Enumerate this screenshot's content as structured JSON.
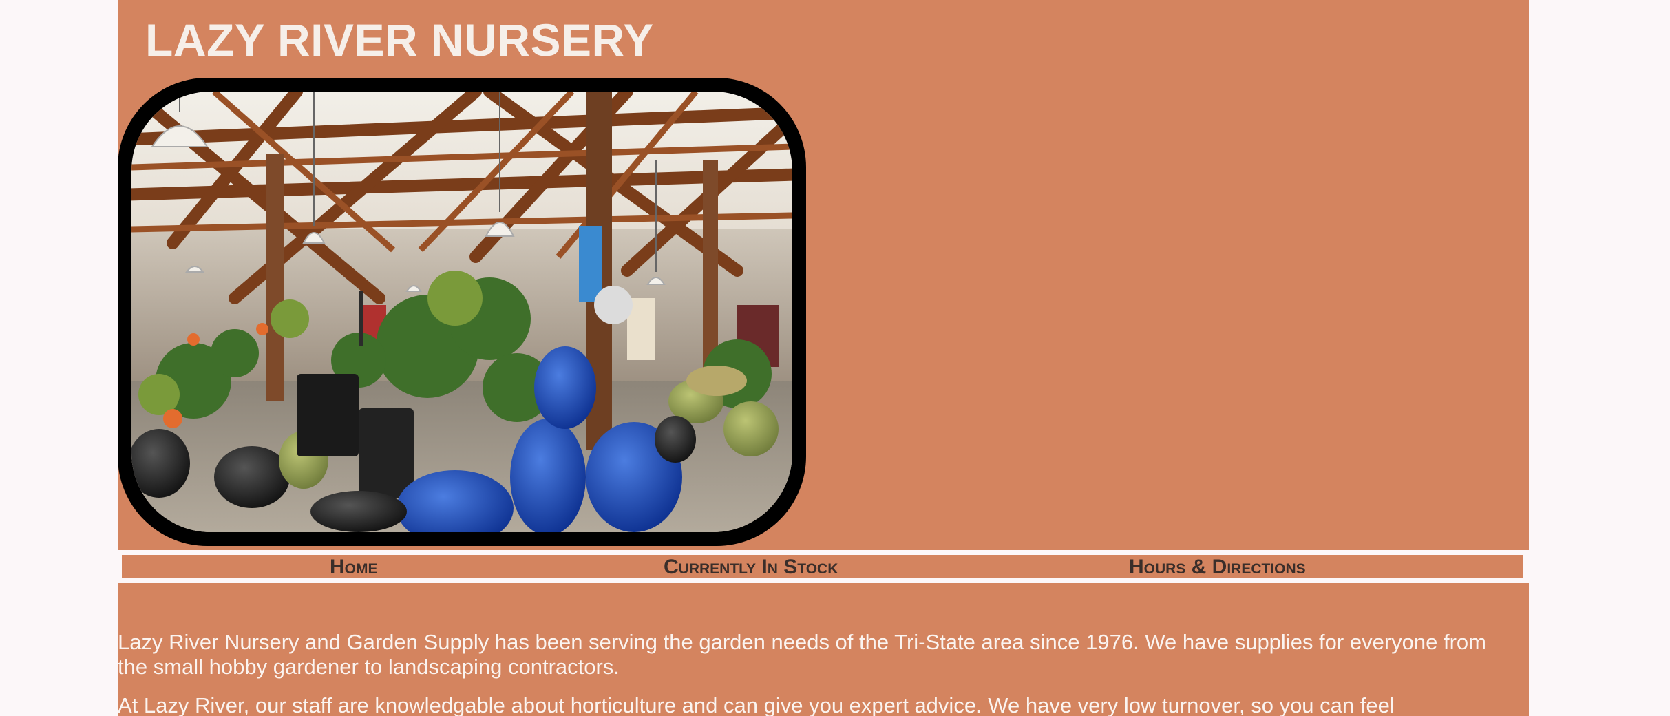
{
  "site": {
    "title": "LAZY RIVER NURSERY"
  },
  "hero": {
    "image_alt": "Nursery interior with wooden rafters, hanging lamps, plants and glazed pots",
    "icon": "photo"
  },
  "nav": {
    "items": [
      {
        "label": "Home"
      },
      {
        "label": "Currently In Stock"
      },
      {
        "label": "Hours & Directions"
      }
    ]
  },
  "main": {
    "paragraphs": [
      "Lazy River Nursery and Garden Supply has been serving the garden needs of the Tri-State area since 1976. We have supplies for everyone from the small hobby gardener to landscaping contractors.",
      "At Lazy River, our staff are knowledgable about horticulture and can give you expert advice. We have very low turnover, so you can feel"
    ]
  },
  "colors": {
    "page_background": "#fcf7f9",
    "panel": "#d4845f",
    "title_text": "#f6efe9",
    "nav_text": "#3a2e2a",
    "body_text": "#fbf4f0"
  }
}
